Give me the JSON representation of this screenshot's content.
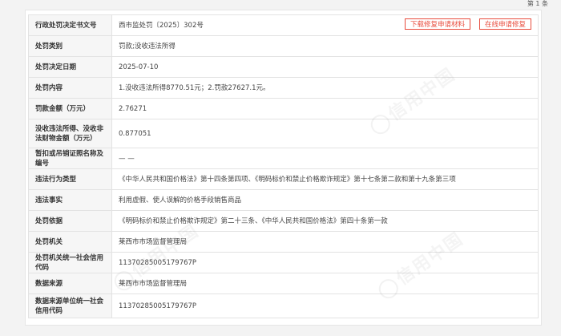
{
  "pagination": {
    "count_text": "第 1 条"
  },
  "record": {
    "rows": [
      {
        "label": "行政处罚决定书文号",
        "value": "西市监处罚〔2025〕302号"
      },
      {
        "label": "处罚类别",
        "value": "罚款;没收违法所得"
      },
      {
        "label": "处罚决定日期",
        "value": "2025-07-10"
      },
      {
        "label": "处罚内容",
        "value": "1.没收违法所得8770.51元；2.罚款27627.1元。"
      },
      {
        "label": "罚款金额（万元）",
        "value": "2.76271"
      },
      {
        "label": "没收违法所得、没收非法财物金额（万元）",
        "value": "0.877051"
      },
      {
        "label": "暂扣或吊销证照名称及编号",
        "value": "— —"
      },
      {
        "label": "违法行为类型",
        "value": "《中华人民共和国价格法》第十四条第四项、《明码标价和禁止价格欺诈规定》第十七条第二款和第十九条第三项"
      },
      {
        "label": "违法事实",
        "value": "利用虚假、使人误解的价格手段销售商品"
      },
      {
        "label": "处罚依据",
        "value": "《明码标价和禁止价格欺诈规定》第二十三条、《中华人民共和国价格法》第四十条第一款"
      },
      {
        "label": "处罚机关",
        "value": "莱西市市场监督管理局"
      },
      {
        "label": "处罚机关统一社会信用代码",
        "value": "11370285005179767P"
      },
      {
        "label": "数据来源",
        "value": "莱西市市场监督管理局"
      },
      {
        "label": "数据来源单位统一社会信用代码",
        "value": "11370285005179767P"
      }
    ]
  },
  "actions": {
    "download_label": "下载修复申请材料",
    "repair_label": "在线申请修复"
  },
  "watermark": {
    "text": "信用中国"
  },
  "colors": {
    "accent": "#e84c3d",
    "label_bg": "#f6f6f6",
    "border": "#e3e3e3"
  }
}
